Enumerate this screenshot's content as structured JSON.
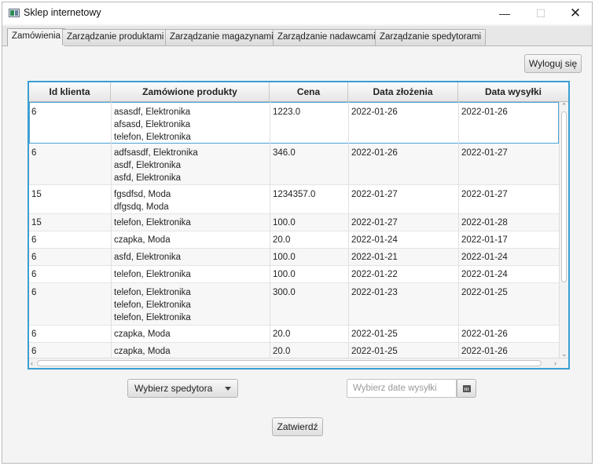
{
  "window": {
    "title": "Sklep internetowy",
    "minimize": "—",
    "maximize": "☐",
    "close": "✕"
  },
  "tabs": [
    "Zamówienia",
    "Zarządzanie produktami",
    "Zarządzanie magazynami",
    "Zarządzanie nadawcami",
    "Zarządzanie spedytorami"
  ],
  "active_tab": 0,
  "logout_label": "Wyloguj się",
  "table": {
    "columns": [
      "Id klienta",
      "Zamówione produkty",
      "Cena",
      "Data złożenia",
      "Data wysyłki"
    ],
    "rows": [
      {
        "client": "6",
        "products": "asasdf, Elektronika\nafsasd, Elektronika\ntelefon, Elektronika",
        "price": "1223.0",
        "ordered": "2022-01-26",
        "shipped": "2022-01-26"
      },
      {
        "client": "6",
        "products": "adfsasdf, Elektronika\nasdf, Elektronika\nasfd, Elektronika",
        "price": "346.0",
        "ordered": "2022-01-26",
        "shipped": "2022-01-27"
      },
      {
        "client": "15",
        "products": "fgsdfsd, Moda\ndfgsdq, Moda",
        "price": "1234357.0",
        "ordered": "2022-01-27",
        "shipped": "2022-01-27"
      },
      {
        "client": "15",
        "products": "telefon, Elektronika",
        "price": "100.0",
        "ordered": "2022-01-27",
        "shipped": "2022-01-28"
      },
      {
        "client": "6",
        "products": "czapka, Moda",
        "price": "20.0",
        "ordered": "2022-01-24",
        "shipped": "2022-01-17"
      },
      {
        "client": "6",
        "products": "asfd, Elektronika",
        "price": "100.0",
        "ordered": "2022-01-21",
        "shipped": "2022-01-24"
      },
      {
        "client": "6",
        "products": "telefon, Elektronika",
        "price": "100.0",
        "ordered": "2022-01-22",
        "shipped": "2022-01-24"
      },
      {
        "client": "6",
        "products": "telefon, Elektronika\ntelefon, Elektronika\ntelefon, Elektronika",
        "price": "300.0",
        "ordered": "2022-01-23",
        "shipped": "2022-01-25"
      },
      {
        "client": "6",
        "products": "czapka, Moda",
        "price": "20.0",
        "ordered": "2022-01-25",
        "shipped": "2022-01-26"
      },
      {
        "client": "6",
        "products": "czapka, Moda",
        "price": "20.0",
        "ordered": "2022-01-25",
        "shipped": "2022-01-26"
      }
    ]
  },
  "shipper_select": {
    "label": "Wybierz spedytora"
  },
  "ship_date": {
    "value": "",
    "placeholder": "Wybierz date wysyłki"
  },
  "confirm_label": "Zatwierdź",
  "colors": {
    "selection_border": "#3a9ed2",
    "window_bg": "#f4f4f4"
  },
  "icons": {
    "app": "app-window-icon",
    "calendar": "calendar-icon",
    "dropdown": "chevron-down-icon"
  }
}
